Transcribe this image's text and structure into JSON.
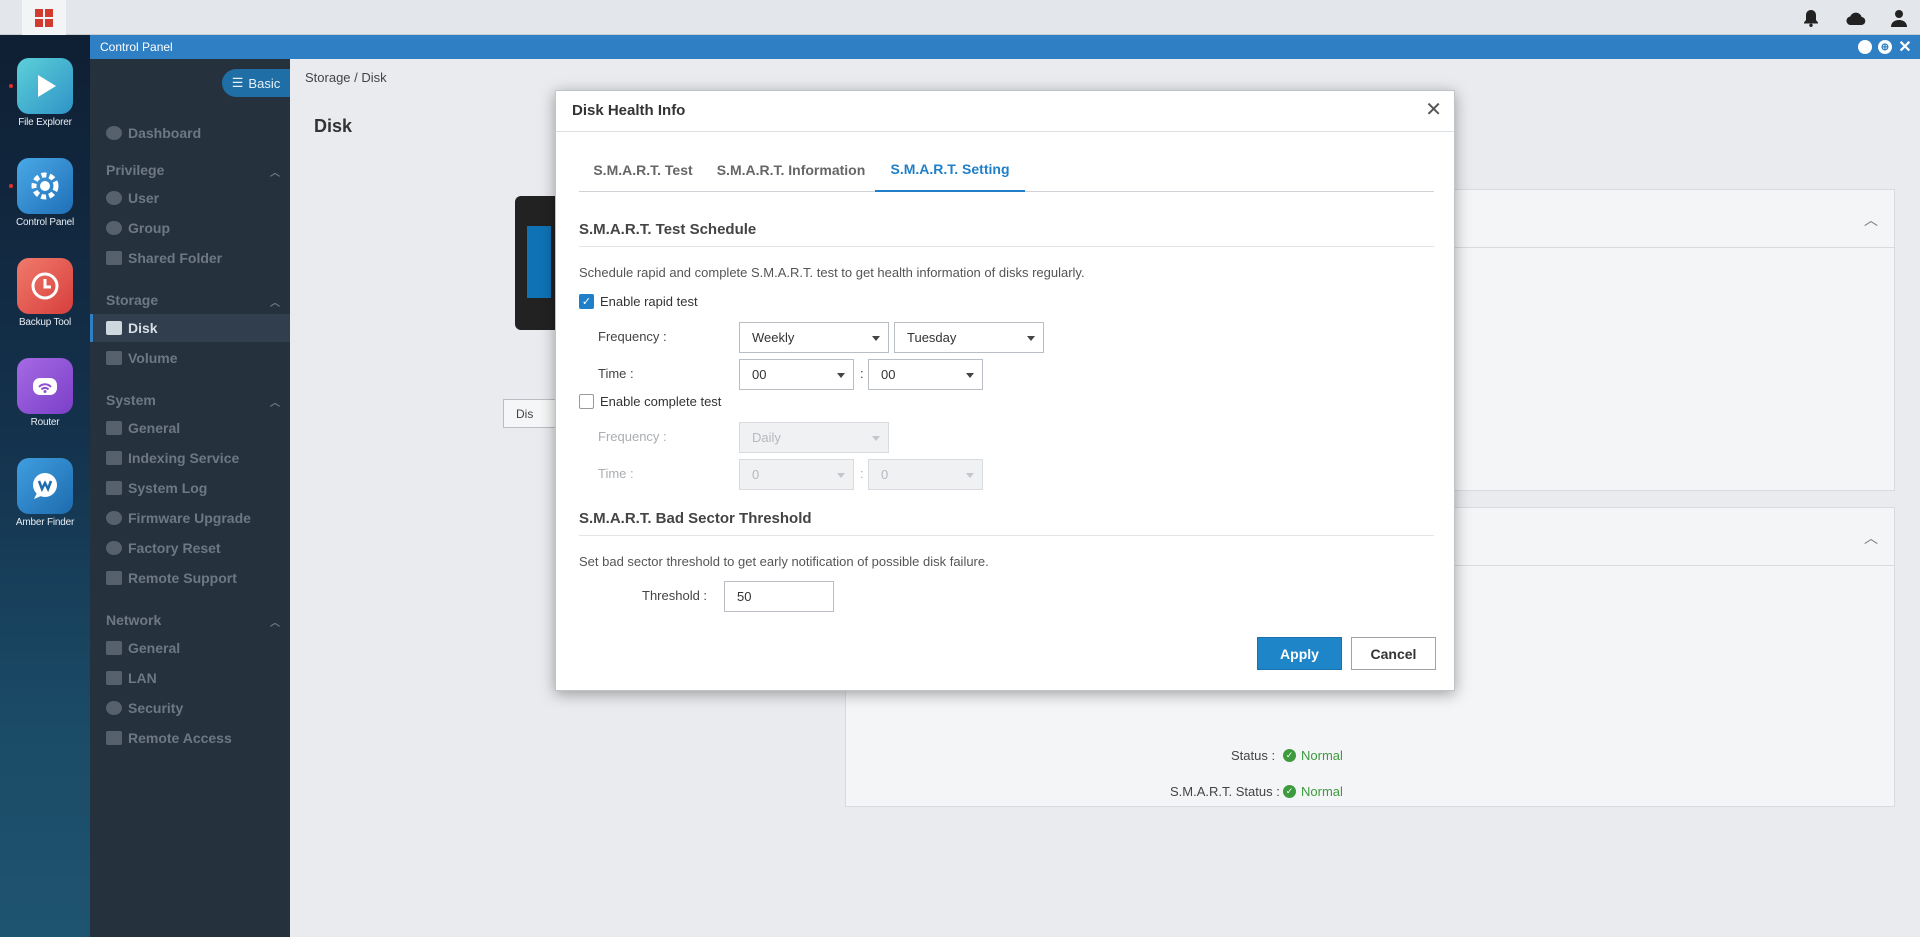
{
  "window": {
    "title": "Control Panel"
  },
  "dock": {
    "apps": [
      {
        "label": "File Explorer",
        "icon": "file-explorer-icon",
        "color": "#3fb7c9"
      },
      {
        "label": "Control Panel",
        "icon": "control-panel-icon",
        "color": "#2a8fd6"
      },
      {
        "label": "Backup Tool",
        "icon": "backup-tool-icon",
        "color": "#e4534a"
      },
      {
        "label": "Router",
        "icon": "router-icon",
        "color": "#8e4fd3"
      },
      {
        "label": "Amber Finder",
        "icon": "amber-finder-icon",
        "color": "#2b86c8"
      }
    ]
  },
  "sidebar": {
    "mode_label": "Basic",
    "dashboard": "Dashboard",
    "categories": {
      "privilege": "Privilege",
      "storage": "Storage",
      "system": "System",
      "network": "Network"
    },
    "privilege_items": [
      "User",
      "Group",
      "Shared Folder"
    ],
    "storage_items": [
      "Disk",
      "Volume"
    ],
    "system_items": [
      "General",
      "Indexing Service",
      "System Log",
      "Firmware Upgrade",
      "Factory Reset",
      "Remote Support"
    ],
    "network_items": [
      "General",
      "LAN",
      "Security",
      "Remote Access"
    ]
  },
  "content": {
    "breadcrumb": "Storage / Disk",
    "page_title": "Disk",
    "bg_button_label": "Dis",
    "status_label": "Status :",
    "status_value": "Normal",
    "smart_status_label": "S.M.A.R.T. Status :",
    "smart_status_value": "Normal"
  },
  "modal": {
    "title": "Disk Health Info",
    "tabs": [
      "S.M.A.R.T. Test",
      "S.M.A.R.T. Information",
      "S.M.A.R.T. Setting"
    ],
    "active_tab": "S.M.A.R.T. Setting",
    "schedule": {
      "title": "S.M.A.R.T. Test Schedule",
      "description": "Schedule rapid and complete S.M.A.R.T. test to get health information of disks regularly.",
      "rapid": {
        "label": "Enable rapid test",
        "checked": true,
        "frequency_label": "Frequency :",
        "frequency": "Weekly",
        "day": "Tuesday",
        "time_label": "Time :",
        "hour": "00",
        "minute": "00",
        "separator": ":"
      },
      "complete": {
        "label": "Enable complete test",
        "checked": false,
        "frequency_label": "Frequency :",
        "frequency": "Daily",
        "time_label": "Time :",
        "hour": "0",
        "minute": "0",
        "separator": ":"
      }
    },
    "threshold": {
      "title": "S.M.A.R.T. Bad Sector Threshold",
      "description": "Set bad sector threshold to get early notification of possible disk failure.",
      "label": "Threshold :",
      "value": "50"
    },
    "apply_label": "Apply",
    "cancel_label": "Cancel"
  },
  "colors": {
    "accent": "#1f7fc8",
    "titlebar": "#2f7fc4",
    "sidebar_bg": "#26313e",
    "ok_green": "#3d9a3d"
  }
}
